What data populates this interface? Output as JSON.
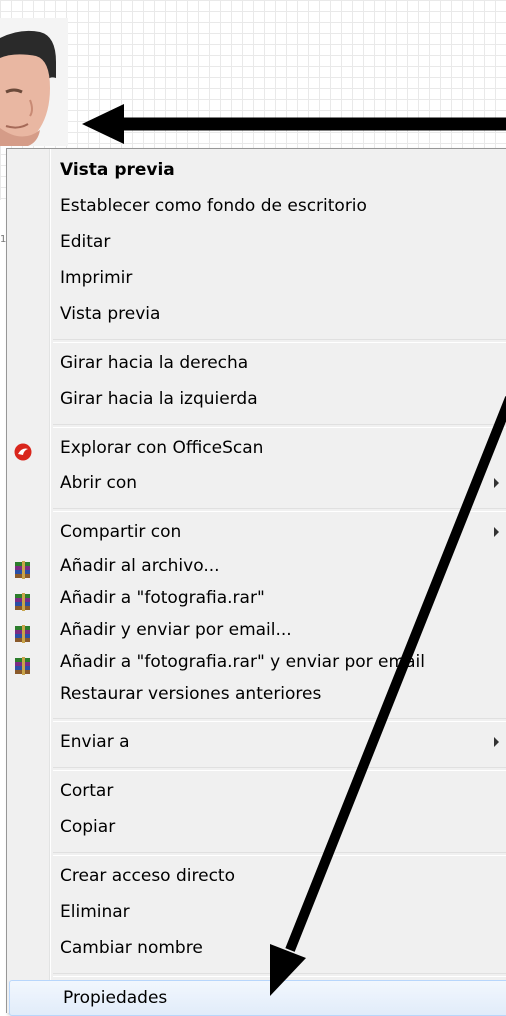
{
  "menu": {
    "items": [
      {
        "label": "Vista previa",
        "icon": null,
        "submenu": false
      },
      {
        "label": "Establecer como fondo de escritorio",
        "icon": null,
        "submenu": false
      },
      {
        "label": "Editar",
        "icon": null,
        "submenu": false
      },
      {
        "label": "Imprimir",
        "icon": null,
        "submenu": false
      },
      {
        "label": "Vista previa",
        "icon": null,
        "submenu": false
      },
      {
        "label": "Girar hacia la derecha",
        "icon": null,
        "submenu": false
      },
      {
        "label": "Girar hacia la izquierda",
        "icon": null,
        "submenu": false
      },
      {
        "label": "Explorar con OfficeScan",
        "icon": "officescan-icon",
        "submenu": false
      },
      {
        "label": "Abrir con",
        "icon": null,
        "submenu": true
      },
      {
        "label": "Compartir con",
        "icon": null,
        "submenu": true
      },
      {
        "label": "Añadir al archivo...",
        "icon": "winrar-icon",
        "submenu": false
      },
      {
        "label": "Añadir a \"fotografia.rar\"",
        "icon": "winrar-icon",
        "submenu": false
      },
      {
        "label": "Añadir y enviar por email...",
        "icon": "winrar-icon",
        "submenu": false
      },
      {
        "label": "Añadir a \"fotografia.rar\" y enviar por email",
        "icon": "winrar-icon",
        "submenu": false
      },
      {
        "label": "Restaurar versiones anteriores",
        "icon": null,
        "submenu": false
      },
      {
        "label": "Enviar a",
        "icon": null,
        "submenu": true
      },
      {
        "label": "Cortar",
        "icon": null,
        "submenu": false
      },
      {
        "label": "Copiar",
        "icon": null,
        "submenu": false
      },
      {
        "label": "Crear acceso directo",
        "icon": null,
        "submenu": false
      },
      {
        "label": "Eliminar",
        "icon": null,
        "submenu": false
      },
      {
        "label": "Cambiar nombre",
        "icon": null,
        "submenu": false
      },
      {
        "label": "Propiedades",
        "icon": null,
        "submenu": false
      }
    ],
    "highlighted": "Propiedades"
  },
  "background": {
    "photo": "user-photo-thumbnail",
    "tick_label": "1"
  },
  "colors": {
    "menu_bg": "#f0f0f0",
    "highlight": "#e1ecfa",
    "arrow": "#000000",
    "officescan": "#d9261c"
  }
}
